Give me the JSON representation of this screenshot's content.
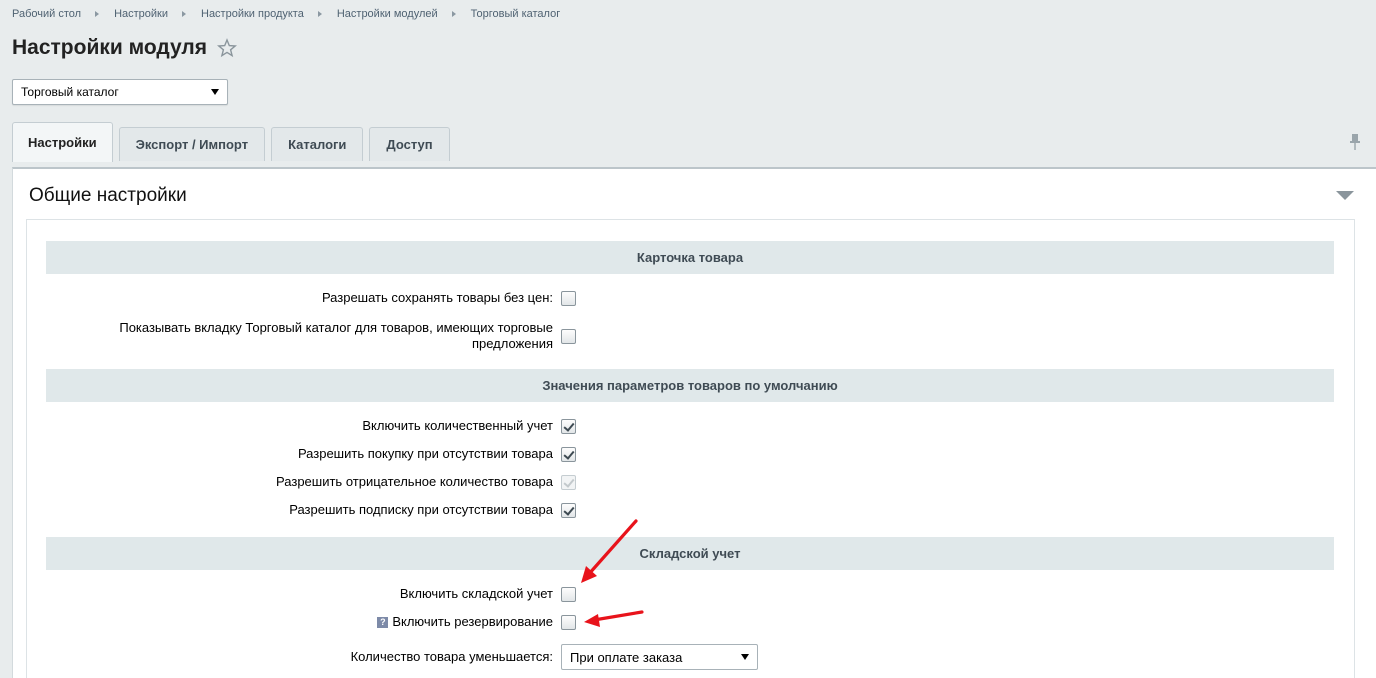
{
  "breadcrumb": [
    "Рабочий стол",
    "Настройки",
    "Настройки продукта",
    "Настройки модулей",
    "Торговый каталог"
  ],
  "page_title": "Настройки модуля",
  "module_select": "Торговый каталог",
  "tabs": [
    "Настройки",
    "Экспорт / Импорт",
    "Каталоги",
    "Доступ"
  ],
  "panel_title": "Общие настройки",
  "sections": {
    "card": "Карточка товара",
    "defaults": "Значения параметров товаров по умолчанию",
    "stock": "Складской учет"
  },
  "fields": {
    "save_without_price": {
      "label": "Разрешать сохранять товары без цен:",
      "checked": false
    },
    "show_catalog_tab": {
      "label": "Показывать вкладку Торговый каталог для товаров, имеющих торговые предложения",
      "checked": false
    },
    "enable_quantity": {
      "label": "Включить количественный учет",
      "checked": true
    },
    "allow_purchase": {
      "label": "Разрешить покупку при отсутствии товара",
      "checked": true
    },
    "allow_negative": {
      "label": "Разрешить отрицательное количество товара",
      "checked": true,
      "disabled": true
    },
    "allow_subscribe": {
      "label": "Разрешить подписку при отсутствии товара",
      "checked": true
    },
    "enable_stock": {
      "label": "Включить складской учет",
      "checked": false
    },
    "enable_reserve": {
      "label": "Включить резервирование",
      "checked": false
    },
    "qty_decrease": {
      "label": "Количество товара уменьшается:",
      "value": "При оплате заказа"
    }
  },
  "annotation_color": "#e8131b"
}
